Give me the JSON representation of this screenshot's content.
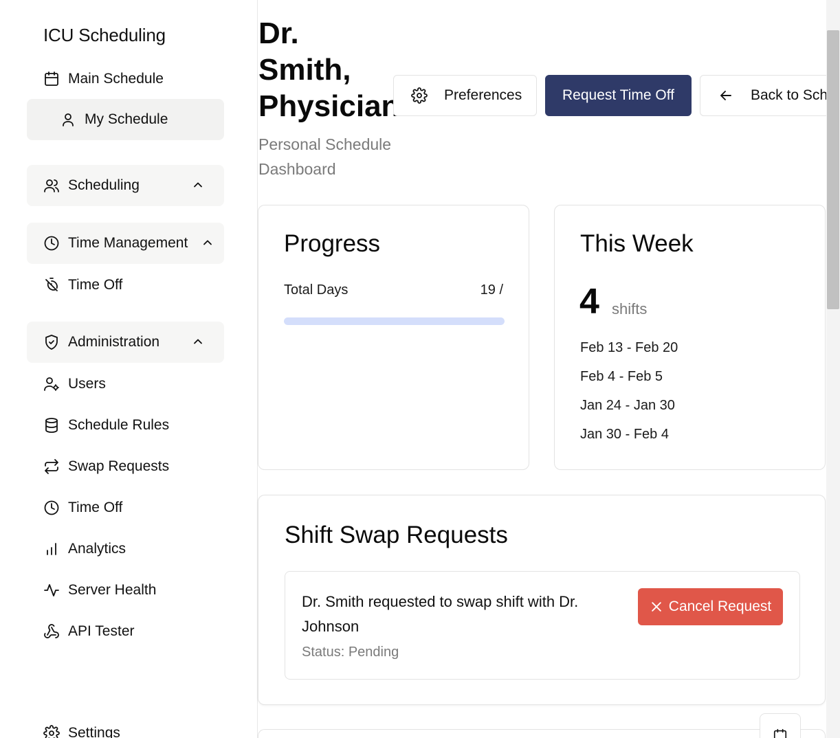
{
  "sidebar": {
    "brand": "ICU Scheduling",
    "main_schedule": "Main Schedule",
    "my_schedule": "My Schedule",
    "scheduling": "Scheduling",
    "time_management": "Time Management",
    "time_off_1": "Time Off",
    "administration": "Administration",
    "users": "Users",
    "schedule_rules": "Schedule Rules",
    "swap_requests": "Swap Requests",
    "time_off_2": "Time Off",
    "analytics": "Analytics",
    "server_health": "Server Health",
    "api_tester": "API Tester",
    "settings": "Settings"
  },
  "header": {
    "title": "Dr. Smith, Physician",
    "subtitle": "Personal Schedule Dashboard",
    "preferences_label": "Preferences",
    "request_time_off_label": "Request Time Off",
    "back_label": "Back to Sch"
  },
  "progress": {
    "title": "Progress",
    "label": "Total Days",
    "value_text": "19 /",
    "fill_fraction": 1.0
  },
  "this_week": {
    "title": "This Week",
    "count": "4",
    "unit": "shifts",
    "ranges": [
      "Feb 13 - Feb 20",
      "Feb 4 - Feb 5",
      "Jan 24 - Jan 30",
      "Jan 30 - Feb 4"
    ]
  },
  "swap": {
    "title": "Shift Swap Requests",
    "request_text": "Dr. Smith requested to swap shift with Dr. Johnson",
    "status": "Status: Pending",
    "cancel_label": "Cancel Request"
  },
  "colors": {
    "primary": "#2f3a68",
    "danger": "#e05749",
    "progress_bar": "#d4defb"
  }
}
